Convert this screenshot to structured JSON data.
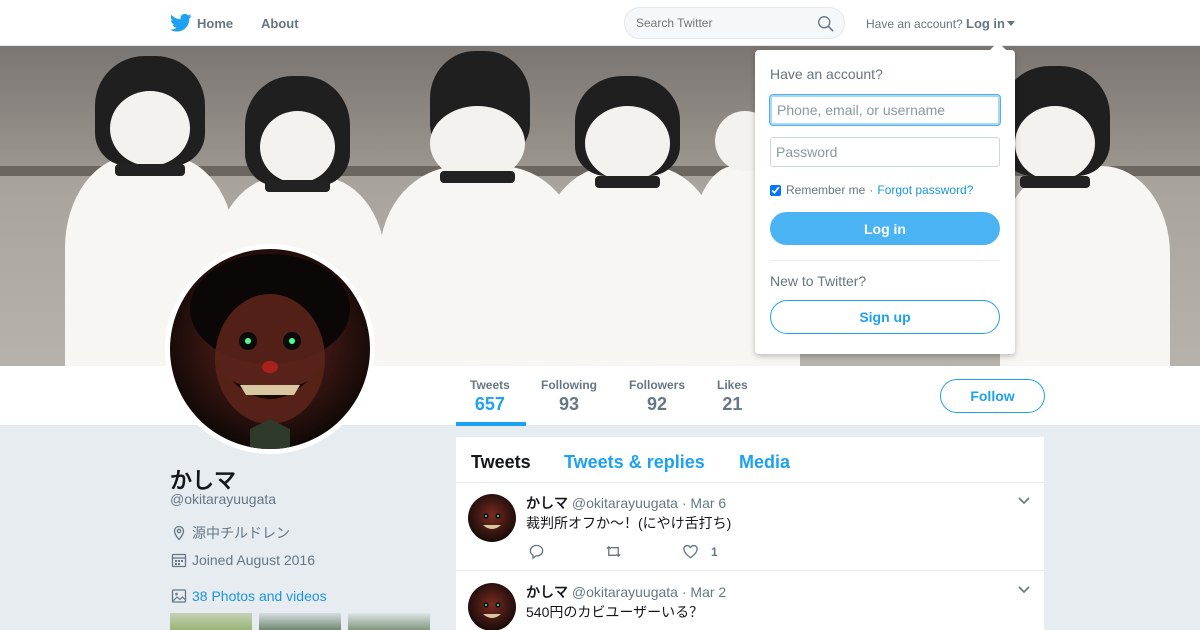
{
  "nav": {
    "home_label": "Home",
    "about_label": "About",
    "search_placeholder": "Search Twitter",
    "have_account": "Have an account?",
    "login_label": "Log in"
  },
  "profile": {
    "name": "かしマ",
    "handle": "@okitarayuugata",
    "location": "源中チルドレン",
    "joined": "Joined August 2016",
    "photos_label": "38 Photos and videos"
  },
  "stats": [
    {
      "label": "Tweets",
      "value": "657"
    },
    {
      "label": "Following",
      "value": "93"
    },
    {
      "label": "Followers",
      "value": "92"
    },
    {
      "label": "Likes",
      "value": "21"
    }
  ],
  "follow_label": "Follow",
  "tabs": [
    "Tweets",
    "Tweets & replies",
    "Media"
  ],
  "tweets": [
    {
      "name": "かしマ",
      "handle": "@okitarayuugata",
      "sep": "·",
      "date": "Mar 6",
      "text": "裁判所オフか〜！(にやけ舌打ち)",
      "likes": "1"
    },
    {
      "name": "かしマ",
      "handle": "@okitarayuugata",
      "sep": "·",
      "date": "Mar 2",
      "text": "540円のカビユーザーいる？"
    }
  ],
  "login_dropdown": {
    "title": "Have an account?",
    "username_placeholder": "Phone, email, or username",
    "password_placeholder": "Password",
    "remember_label": "Remember me",
    "separator": "·",
    "forgot_label": "Forgot password?",
    "login_button": "Log in",
    "new_to_twitter": "New to Twitter?",
    "signup_button": "Sign up"
  },
  "colors": {
    "accent": "#1da1f2",
    "background": "#e6ecf0",
    "muted_text": "#657786"
  }
}
